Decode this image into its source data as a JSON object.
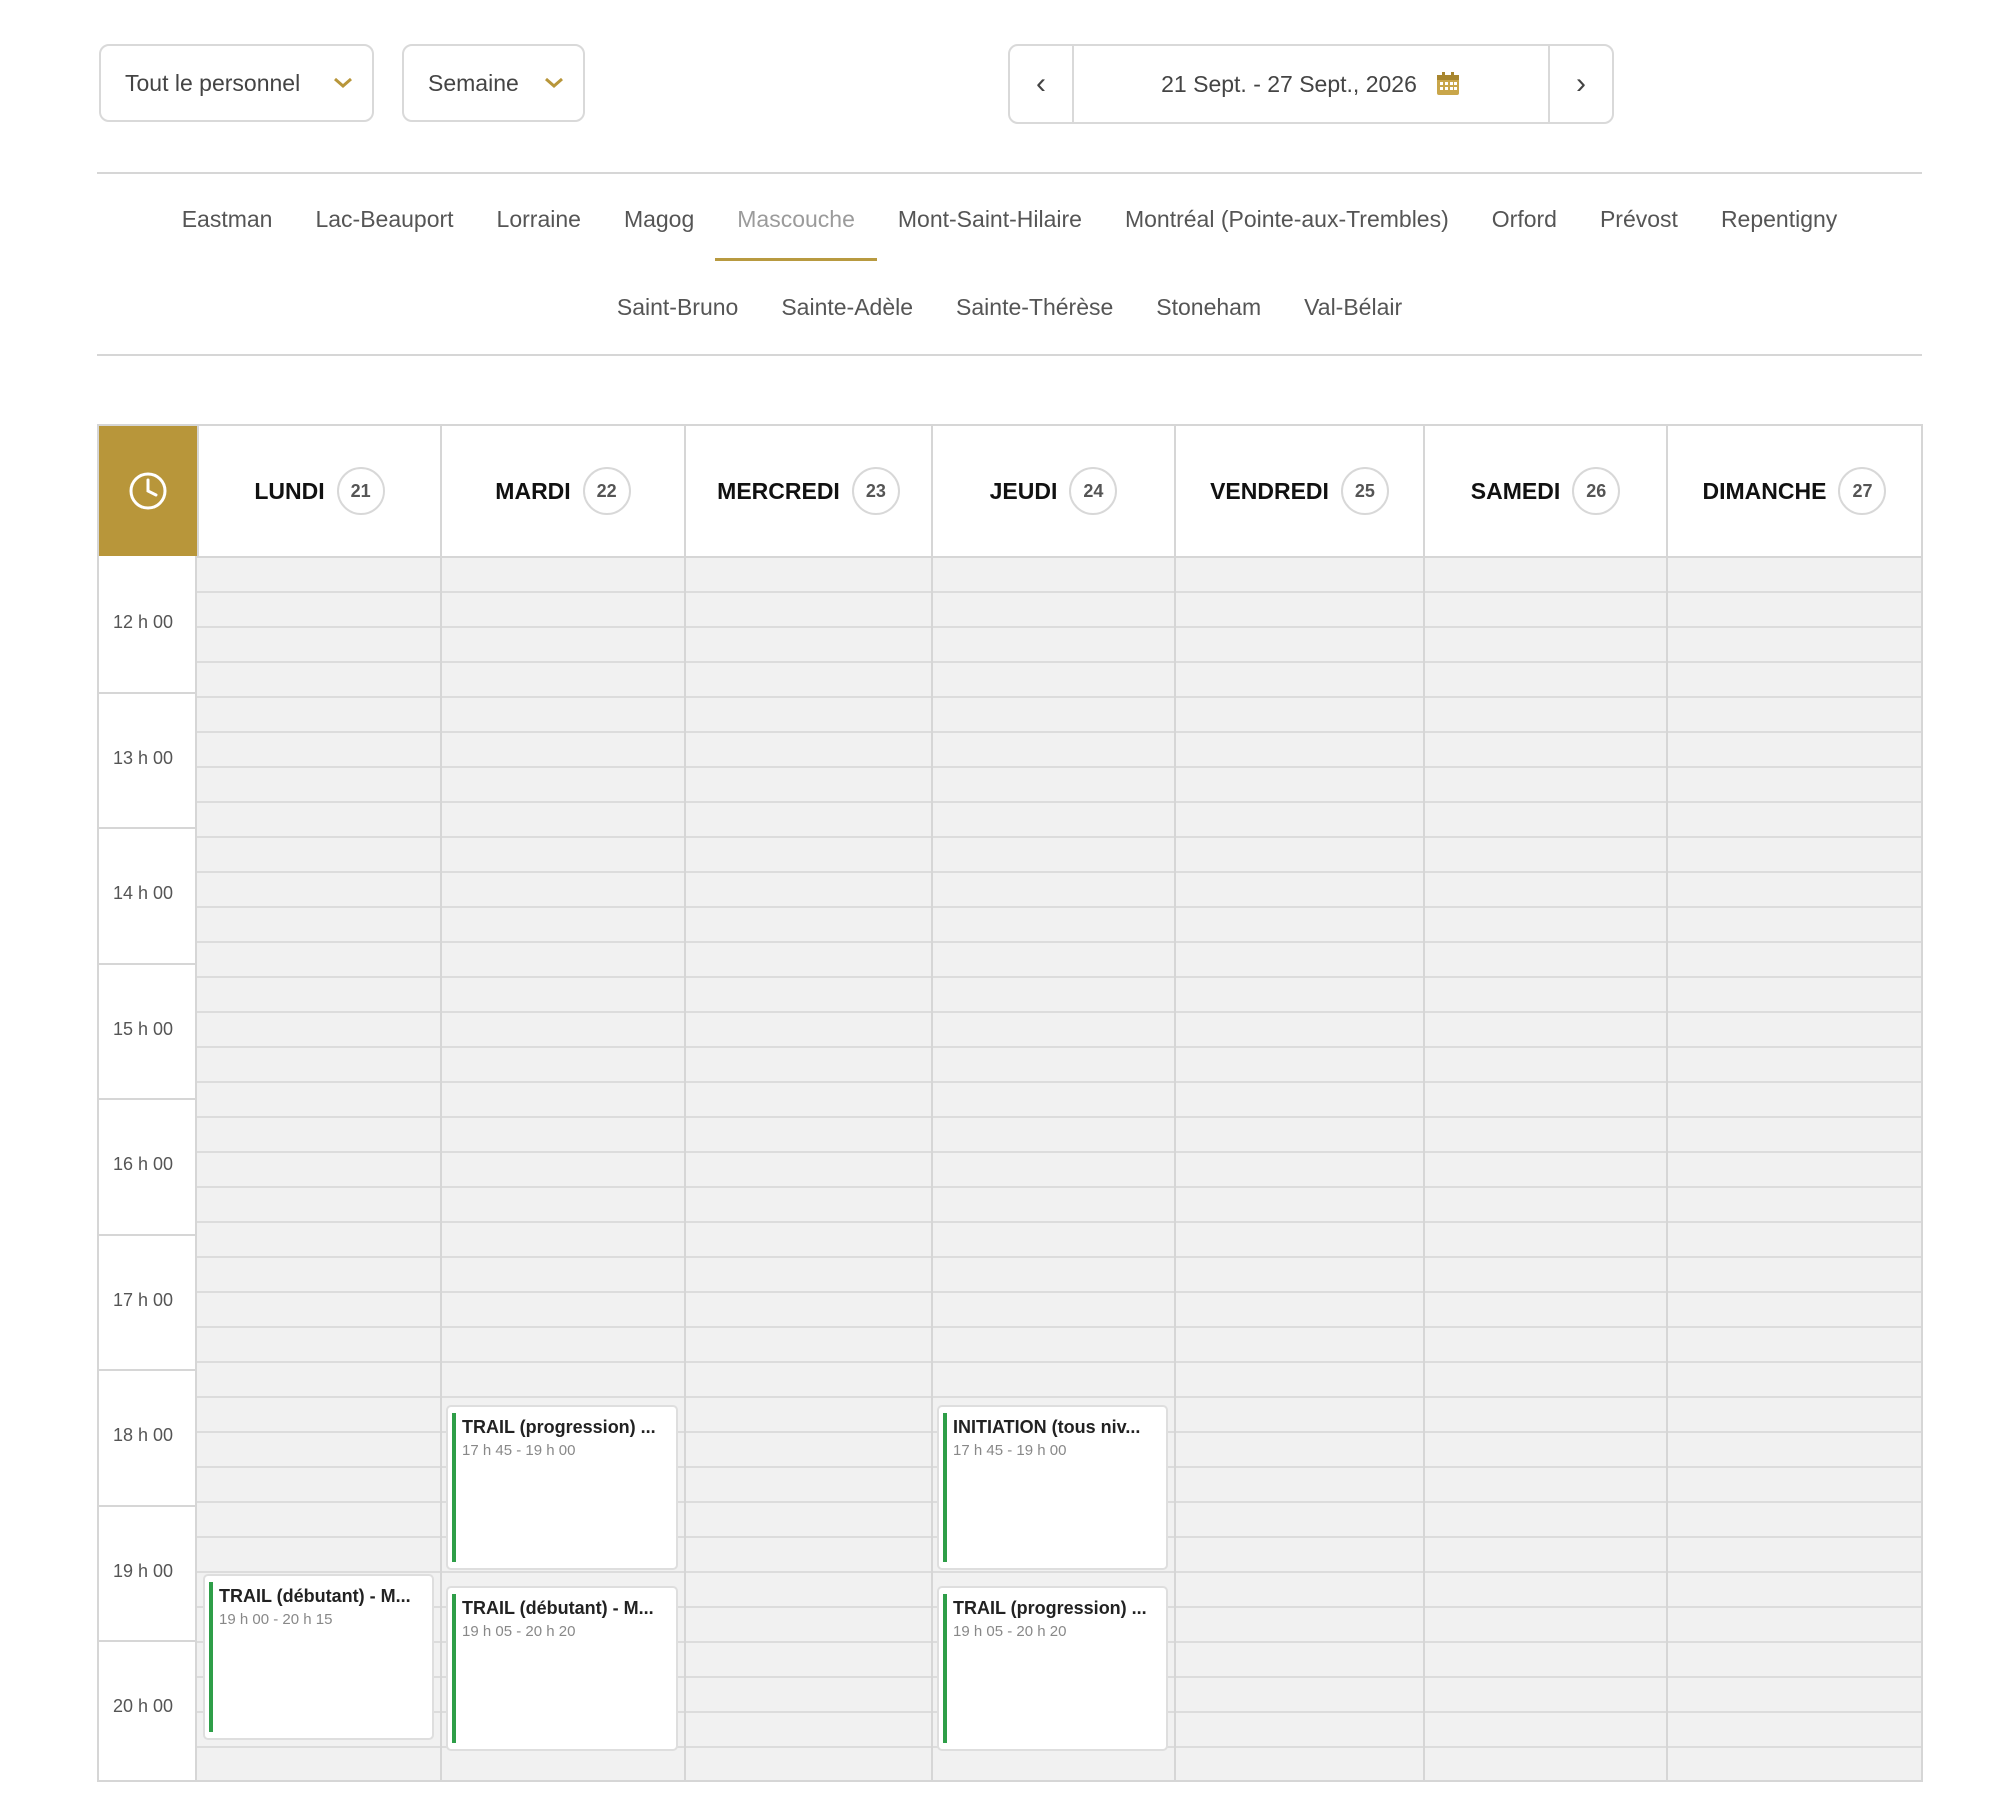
{
  "filters": {
    "staff": {
      "label": "Tout le personnel",
      "icon": "chevron-down-icon"
    },
    "view": {
      "label": "Semaine",
      "icon": "chevron-down-icon"
    }
  },
  "date_nav": {
    "prev_glyph": "‹",
    "next_glyph": "›",
    "range_label": "21 Sept. - 27 Sept., 2026",
    "calendar_icon": "calendar-icon"
  },
  "locations": {
    "row1": [
      "Eastman",
      "Lac-Beauport",
      "Lorraine",
      "Magog",
      "Mascouche",
      "Mont-Saint-Hilaire",
      "Montréal (Pointe-aux-Trembles)",
      "Orford",
      "Prévost",
      "Repentigny"
    ],
    "row2": [
      "Saint-Bruno",
      "Sainte-Adèle",
      "Sainte-Thérèse",
      "Stoneham",
      "Val-Bélair"
    ],
    "active": "Mascouche"
  },
  "calendar": {
    "clock_icon": "clock-icon",
    "accent_color": "#b8963a",
    "event_bar_color": "#2e9e48",
    "days": [
      {
        "name": "LUNDI",
        "num": "21"
      },
      {
        "name": "MARDI",
        "num": "22"
      },
      {
        "name": "MERCREDI",
        "num": "23"
      },
      {
        "name": "JEUDI",
        "num": "24"
      },
      {
        "name": "VENDREDI",
        "num": "25"
      },
      {
        "name": "SAMEDI",
        "num": "26"
      },
      {
        "name": "DIMANCHE",
        "num": "27"
      }
    ],
    "hours": [
      "12 h 00",
      "13 h 00",
      "14 h 00",
      "15 h 00",
      "16 h 00",
      "17 h 00",
      "18 h 00",
      "19 h 00",
      "20 h 00"
    ],
    "events": [
      {
        "day": 0,
        "title": "TRAIL (débutant) - M...",
        "time": "19 h 00 - 20 h 15"
      },
      {
        "day": 1,
        "title": "TRAIL (progression) ...",
        "time": "17 h 45 - 19 h 00"
      },
      {
        "day": 1,
        "title": "TRAIL (débutant) - M...",
        "time": "19 h 05 - 20 h 20"
      },
      {
        "day": 3,
        "title": "INITIATION (tous niv...",
        "time": "17 h 45 - 19 h 00"
      },
      {
        "day": 3,
        "title": "TRAIL (progression) ...",
        "time": "19 h 05 - 20 h 20"
      }
    ]
  }
}
